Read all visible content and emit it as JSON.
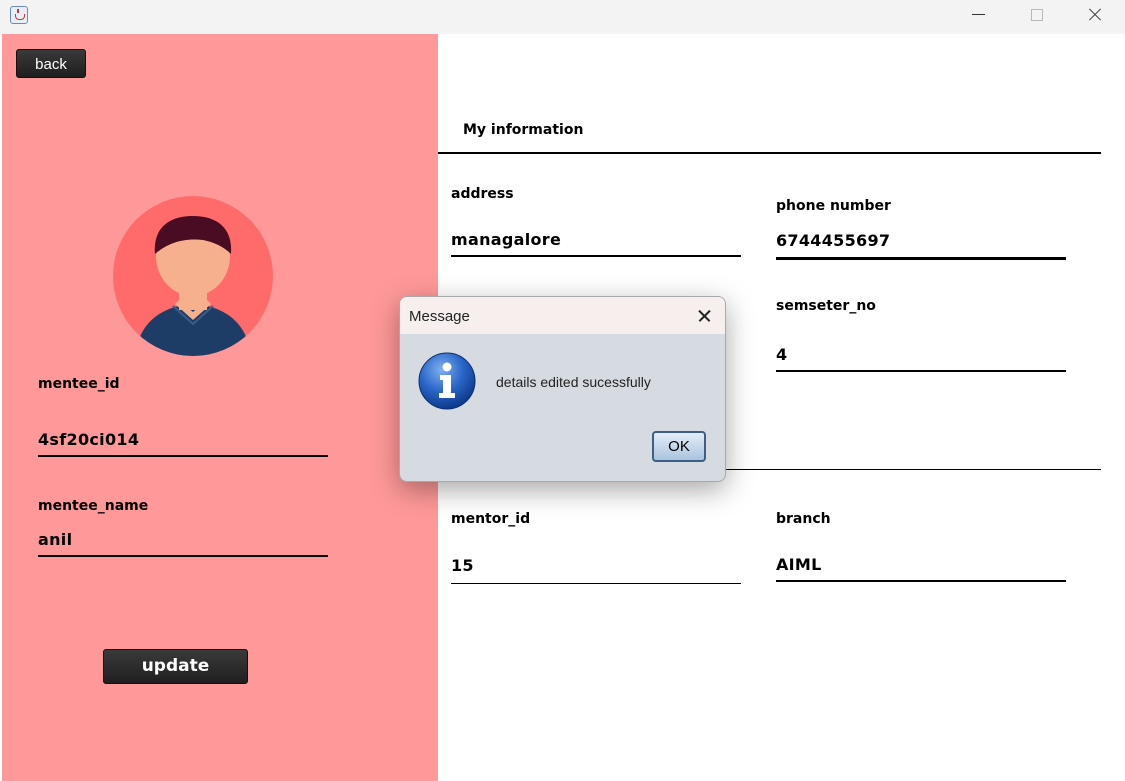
{
  "window": {
    "title": ""
  },
  "left": {
    "back_label": "back",
    "mentee_id_label": "mentee_id",
    "mentee_id_value": "4sf20ci014",
    "mentee_name_label": "mentee_name",
    "mentee_name_value": "anil",
    "update_label": "update"
  },
  "info": {
    "section_title": "My information",
    "address_label": "address",
    "address_value": "managalore",
    "phone_label": "phone number",
    "phone_value": "6744455697",
    "semester_label": "semseter_no",
    "semester_value": "4",
    "mentor_id_label": "mentor_id",
    "mentor_id_value": "15",
    "branch_label": "branch",
    "branch_value": "AIML"
  },
  "dialog": {
    "title": "Message",
    "message": "details edited sucessfully",
    "ok_label": "OK",
    "icon": "info-icon"
  },
  "colors": {
    "left_panel": "#ff9999",
    "avatar_bg": "#ff6b6b",
    "dialog_bg": "#d6dae1"
  }
}
